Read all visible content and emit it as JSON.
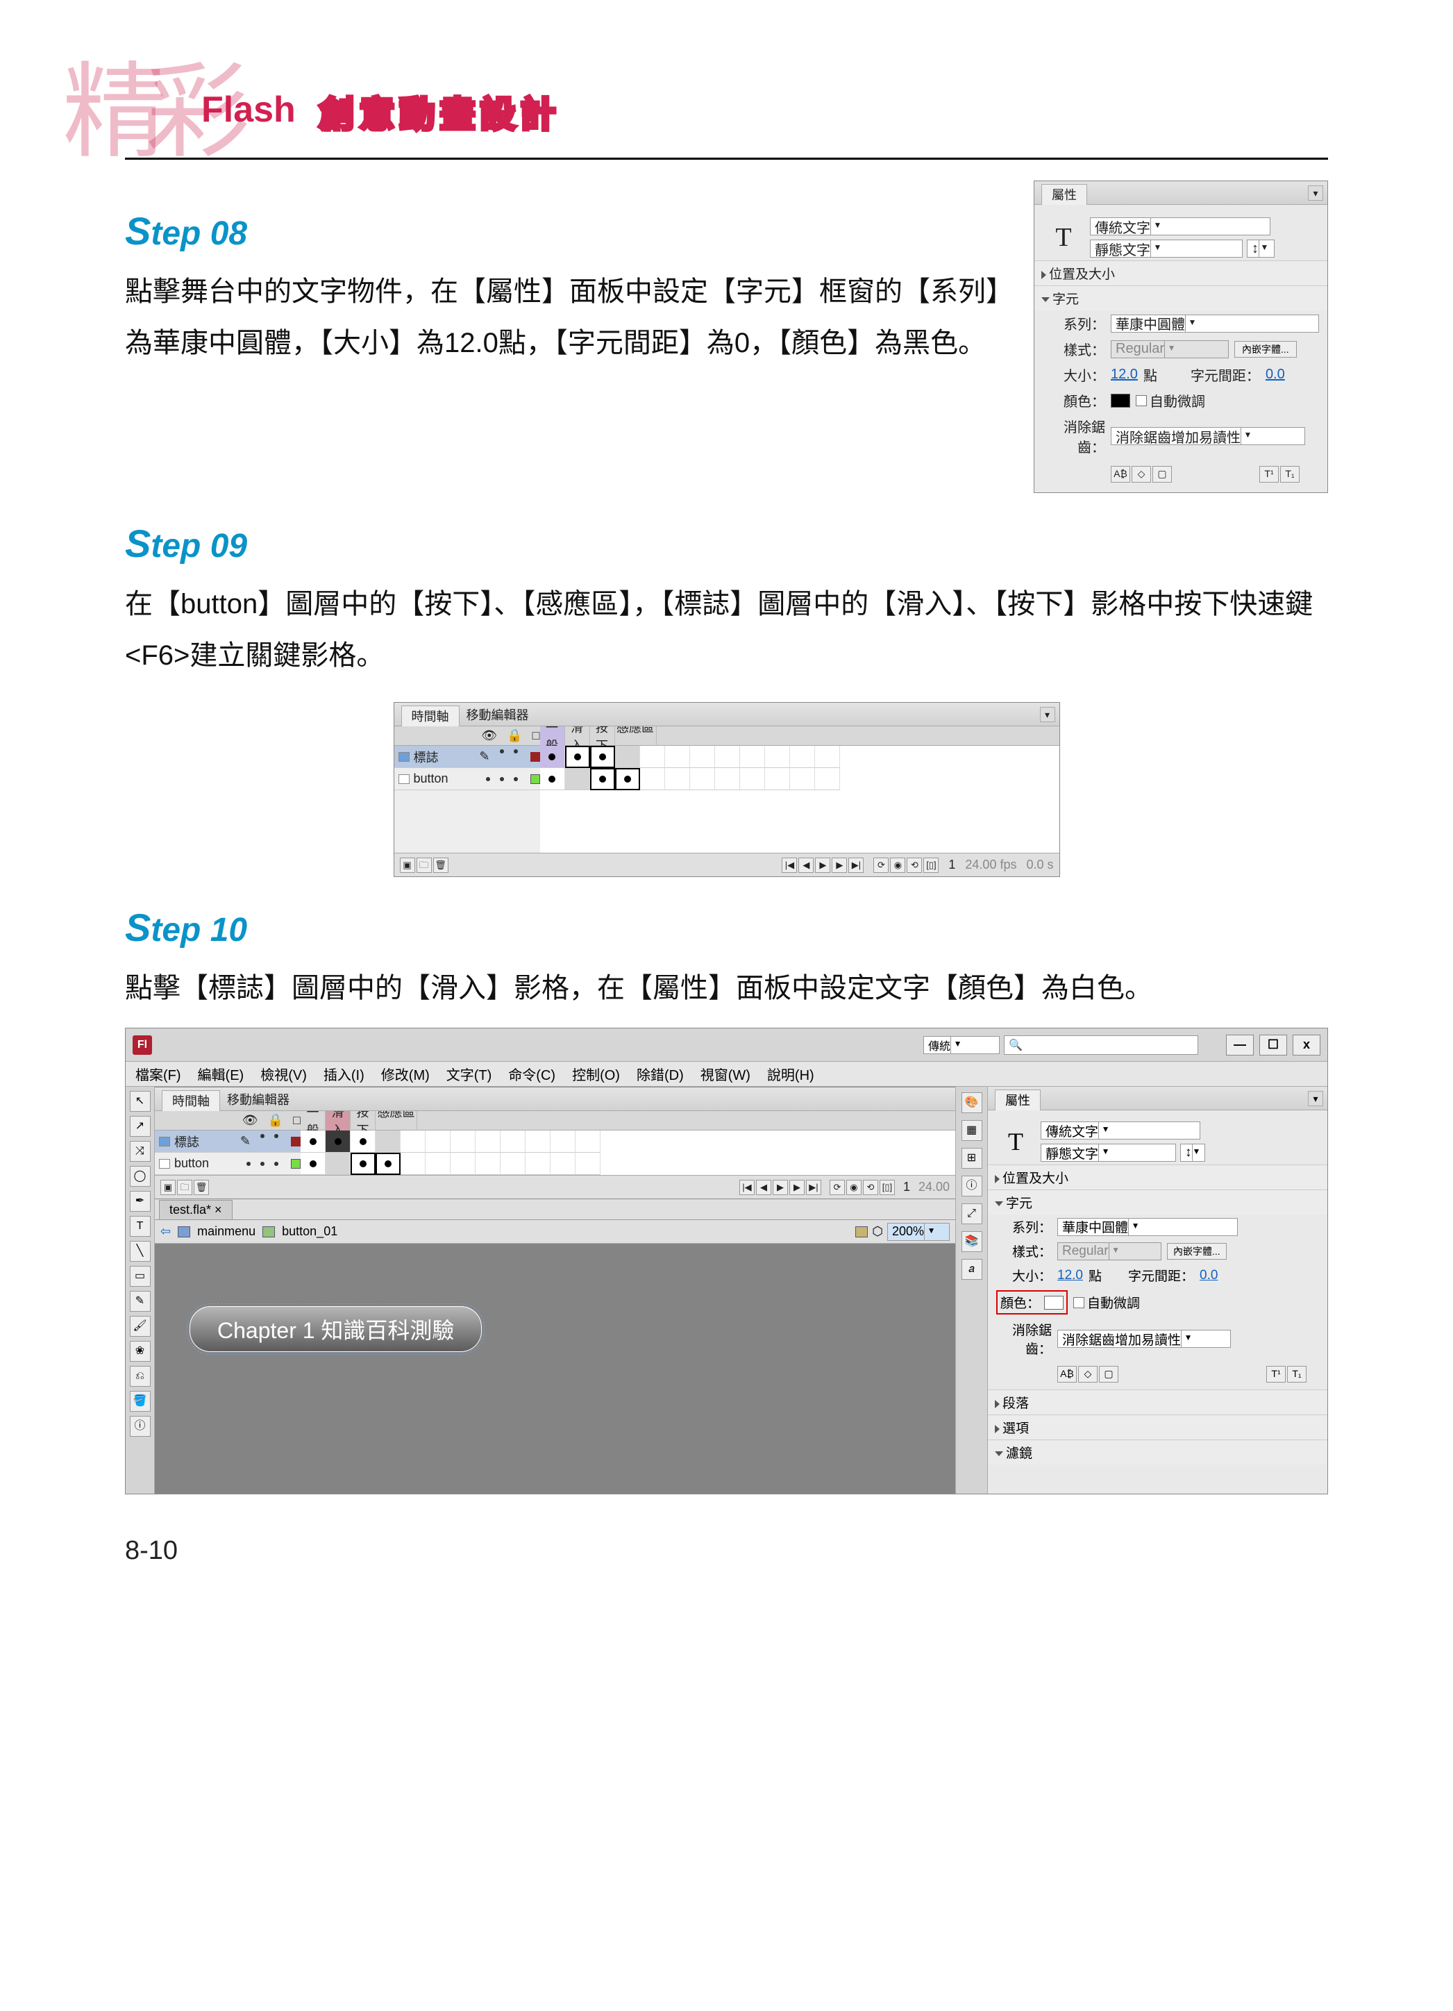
{
  "header": {
    "calli": "精彩",
    "flash": "Flash",
    "sub": "創意動畫設計"
  },
  "step08": {
    "title_s": "S",
    "title_rest": "tep 08",
    "body": "點擊舞台中的文字物件，在【屬性】面板中設定【字元】框窗的【系列】為華康中圓體，【大小】為12.0點，【字元間距】為0，【顏色】為黑色。"
  },
  "panel08": {
    "tab": "屬性",
    "textTool": "T",
    "engine": "傳統文字",
    "textType": "靜態文字",
    "sec_pos": "位置及大小",
    "sec_char": "字元",
    "seriesLabel": "系列：",
    "series": "華康中圓體",
    "styleLabel": "樣式：",
    "style": "Regular",
    "embed": "內嵌字體...",
    "sizeLabel": "大小：",
    "size": "12.0",
    "sizeUnit": "點",
    "trackLabel": "字元間距：",
    "track": "0.0",
    "colorLabel": "顏色：",
    "auto": "自動微調",
    "aaLabel": "消除鋸齒：",
    "aa": "消除鋸齒增加易讀性"
  },
  "step09": {
    "title_s": "S",
    "title_rest": "tep 09",
    "body": "在【button】圖層中的【按下】、【感應區】，【標誌】圖層中的【滑入】、【按下】影格中按下快速鍵<F6>建立關鍵影格。"
  },
  "timeline09": {
    "tabs": [
      "時間軸",
      "移動編輯器"
    ],
    "frameLabels": [
      "一般",
      "滑入",
      "按下",
      "感應區"
    ],
    "layers": [
      "標誌",
      "button"
    ],
    "fps": "24.00 fps",
    "time": "0.0 s",
    "frame": "1"
  },
  "step10": {
    "title_s": "S",
    "title_rest": "tep 10",
    "body": "點擊【標誌】圖層中的【滑入】影格，在【屬性】面板中設定文字【顏色】為白色。"
  },
  "app10": {
    "icon": "Fl",
    "workspace": "傳統",
    "searchGlyph": "🔍",
    "win": {
      "min": "—",
      "max": "☐",
      "close": "x"
    },
    "menu": [
      "檔案(F)",
      "編輯(E)",
      "檢視(V)",
      "插入(I)",
      "修改(M)",
      "文字(T)",
      "命令(C)",
      "控制(O)",
      "除錯(D)",
      "視窗(W)",
      "說明(H)"
    ],
    "timeline": {
      "tabs": [
        "時間軸",
        "移動編輯器"
      ],
      "frameLabels": [
        "一般",
        "滑入",
        "按下",
        "感應區"
      ],
      "layers": [
        "標誌",
        "button"
      ],
      "fps": "24.00",
      "frame": "1"
    },
    "doc": {
      "tab": "test.fla* ×",
      "crumb1": "mainmenu",
      "crumb2": "button_01",
      "zoom": "200%"
    },
    "stageBtn": "Chapter 1 知識百科測驗",
    "props": {
      "tab": "屬性",
      "textTool": "T",
      "engine": "傳統文字",
      "textType": "靜態文字",
      "sec_pos": "位置及大小",
      "sec_char": "字元",
      "seriesLabel": "系列：",
      "series": "華康中圓體",
      "styleLabel": "樣式：",
      "style": "Regular",
      "embed": "內嵌字體...",
      "sizeLabel": "大小：",
      "size": "12.0",
      "sizeUnit": "點",
      "trackLabel": "字元間距：",
      "track": "0.0",
      "colorLabel": "顏色：",
      "auto": "自動微調",
      "aaLabel": "消除鋸齒：",
      "aa": "消除鋸齒增加易讀性",
      "sec_para": "段落",
      "sec_opt": "選項",
      "sec_filt": "濾鏡"
    }
  },
  "pageNo": "8-10"
}
